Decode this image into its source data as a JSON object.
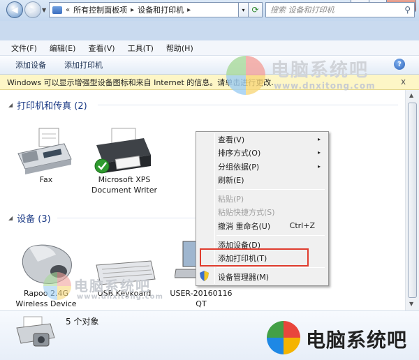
{
  "window": {
    "controls": {
      "minimize": "–",
      "maximize": "□",
      "close": "✕"
    }
  },
  "address": {
    "prefix": "«",
    "crumbs": [
      "所有控制面板项",
      "设备和打印机"
    ],
    "separator": "▸",
    "dropdown": "▾",
    "refresh": "⟳",
    "search_placeholder": "搜索 设备和打印机"
  },
  "menu": {
    "items": [
      "文件(F)",
      "编辑(E)",
      "查看(V)",
      "工具(T)",
      "帮助(H)"
    ]
  },
  "commands": {
    "add_device": "添加设备",
    "add_printer": "添加打印机",
    "help": "?"
  },
  "infobar": {
    "text": "Windows 可以显示增强型设备图标和来自 Internet 的信息。请单击进行更改...",
    "close": "x"
  },
  "groups": {
    "printers": {
      "title": "打印机和传真 (2)"
    },
    "devices": {
      "title": "设备 (3)"
    }
  },
  "printers": [
    {
      "name": "Fax"
    },
    {
      "name": "Microsoft XPS Document Writer"
    }
  ],
  "devices": [
    {
      "name": "Rapoo 2.4G Wireless Device"
    },
    {
      "name": "USB Keykoard"
    },
    {
      "name": "USER-20160116 QT"
    }
  ],
  "context_menu": {
    "items": [
      {
        "label": "查看(V)",
        "submenu": "▸"
      },
      {
        "label": "排序方式(O)",
        "submenu": "▸"
      },
      {
        "label": "分组依据(P)",
        "submenu": "▸"
      },
      {
        "label": "刷新(E)"
      },
      {
        "label": "粘贴(P)",
        "disabled": true
      },
      {
        "label": "粘贴快捷方式(S)",
        "disabled": true
      },
      {
        "label": "撤消 重命名(U)",
        "accel": "Ctrl+Z"
      },
      {
        "label": "添加设备(D)"
      },
      {
        "label": "添加打印机(T)"
      },
      {
        "label": "设备管理器(M)"
      }
    ]
  },
  "status": {
    "count": "5 个对象"
  },
  "watermark": {
    "brand": "电脑系统吧",
    "url": "www.dnxitong.com"
  },
  "colors": {
    "group_title": "#1e3d87",
    "highlight_box": "#e03c2e",
    "infobar_bg": "#fdf6c6"
  }
}
